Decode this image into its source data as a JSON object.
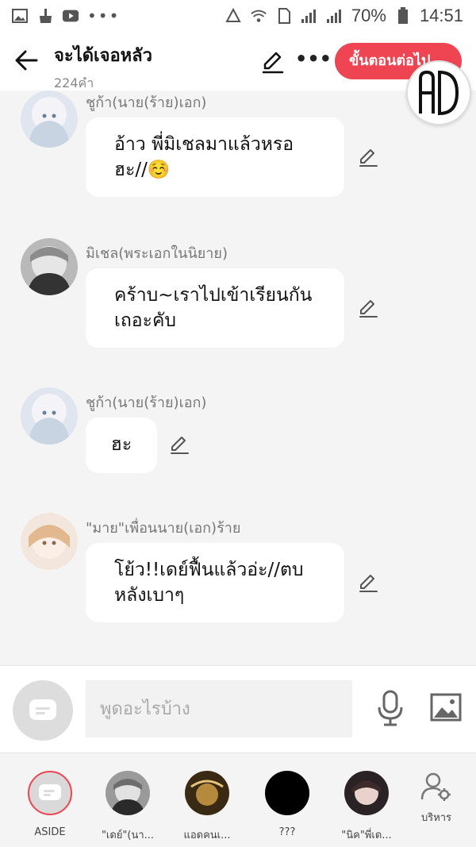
{
  "status_bar": {
    "time": "14:51",
    "battery": "70%"
  },
  "header": {
    "title": "จะได้เจอหลัว",
    "word_count": "224คำ",
    "next_button": "ขั้นตอนต่อไป"
  },
  "messages": [
    {
      "sender": "ชูก้า(นาย(ร้าย)เอก)",
      "text": "อ้าว พี่มิเชลมาแล้วหรอ ฮะ//☺️"
    },
    {
      "sender": "มิเชล(พระเอกในนิยาย)",
      "text": "คร้าบ~เราไปเข้าเรียนกัน เถอะคับ"
    },
    {
      "sender": "ชูก้า(นาย(ร้าย)เอก)",
      "text": "ฮะ"
    },
    {
      "sender": "\"มาย\"เพื่อนนาย(เอก)ร้าย",
      "text": "โย้ว!!เดย์ฟื้นแล้วอ่ะ//ตบ หลังเบาๆ"
    }
  ],
  "input": {
    "placeholder": "พูดอะไรบ้าง"
  },
  "bottom_bar": {
    "characters": [
      {
        "label": "ASIDE"
      },
      {
        "label": "\"เดย์\"(นา..."
      },
      {
        "label": "แอดคนเ..."
      },
      {
        "label": "???"
      },
      {
        "label": "\"นิค\"พี่เด..."
      }
    ],
    "manage_label": "บริหาร"
  },
  "colors": {
    "accent": "#ef4452",
    "background": "#f4f4f4"
  }
}
